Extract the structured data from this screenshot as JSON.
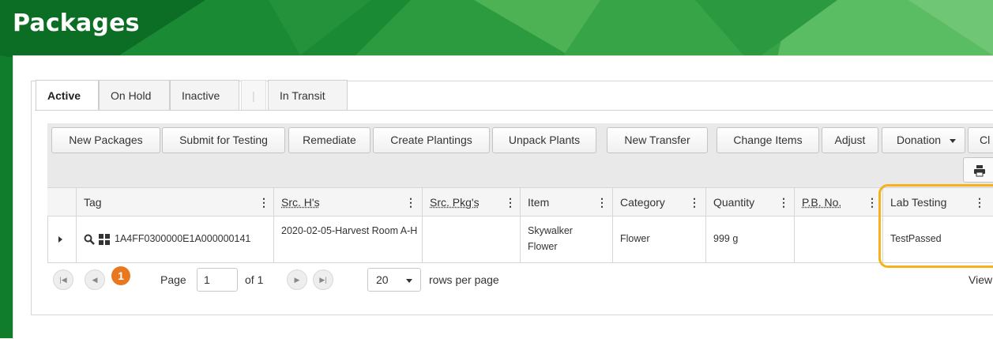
{
  "page": {
    "title": "Packages"
  },
  "colors": {
    "banner_dark": "#0f7d2c",
    "banner_light": "#46b54b",
    "highlight": "#f5b21a",
    "page_badge": "#e8781e"
  },
  "tabs": [
    {
      "label": "Active",
      "active": true
    },
    {
      "label": "On Hold"
    },
    {
      "label": "Inactive"
    },
    {
      "label": "|"
    },
    {
      "label": "In Transit"
    }
  ],
  "toolbar": {
    "buttons": [
      "New Packages",
      "Submit for Testing",
      "Remediate",
      "Create Plantings",
      "Unpack Plants",
      "New Transfer",
      "Change Items",
      "Adjust",
      "Donation",
      "Cl"
    ],
    "print_icon": "printer-icon"
  },
  "columns": [
    "Tag",
    "Src. H's",
    "Src. Pkg's",
    "Item",
    "Category",
    "Quantity",
    "P.B. No.",
    "Lab Testing"
  ],
  "rows": [
    {
      "tag": "1A4FF0300000E1A000000141",
      "src_harvests": "2020-02-05-Harvest Room A-H",
      "src_packages": "",
      "item": "Skywalker Flower",
      "category": "Flower",
      "quantity": "999 g",
      "pb_no": "",
      "lab_testing": "TestPassed"
    }
  ],
  "pager": {
    "current_page": "1",
    "page_label": "Page",
    "page_input": "1",
    "of_label": "of 1",
    "rows_per_page": "20",
    "rows_per_page_label": "rows per page",
    "view_label": "View"
  }
}
